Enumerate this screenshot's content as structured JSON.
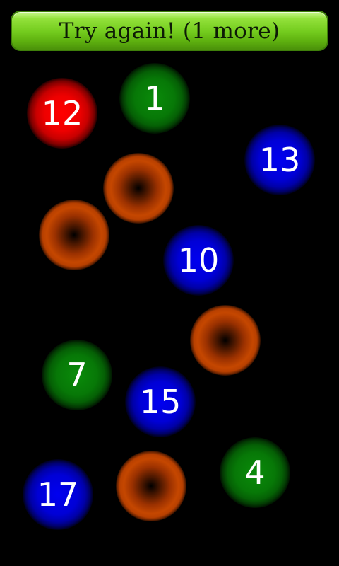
{
  "header": {
    "button_label": "Try again! (1 more)"
  },
  "balls": [
    {
      "number": "12",
      "color": "red"
    },
    {
      "number": "1",
      "color": "green"
    },
    {
      "number": "13",
      "color": "blue"
    },
    {
      "number": "",
      "color": "orange"
    },
    {
      "number": "",
      "color": "orange"
    },
    {
      "number": "10",
      "color": "blue"
    },
    {
      "number": "",
      "color": "orange"
    },
    {
      "number": "7",
      "color": "green"
    },
    {
      "number": "15",
      "color": "blue"
    },
    {
      "number": "4",
      "color": "green"
    },
    {
      "number": "",
      "color": "orange"
    },
    {
      "number": "17",
      "color": "blue"
    }
  ]
}
